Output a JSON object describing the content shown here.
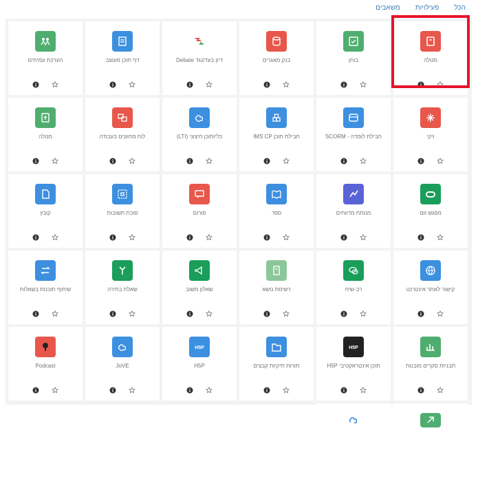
{
  "tabs": [
    {
      "label": "הכל",
      "active": false
    },
    {
      "label": "פעילויות",
      "active": false
    },
    {
      "label": "משאבים",
      "active": true
    }
  ],
  "tiles": [
    {
      "label": "מטלה",
      "color": "#e8574b",
      "icon": "assignment-icon"
    },
    {
      "label": "בוחן",
      "color": "#4fae6f",
      "icon": "quiz-icon"
    },
    {
      "label": "בנק מאגרים",
      "color": "#e8574b",
      "icon": "database-icon"
    },
    {
      "label": "דיון בעד/נגד Debate",
      "color": "#ffffff",
      "icon": "debate-icon"
    },
    {
      "label": "דף תוכן מעוצב",
      "color": "#3d8fe0",
      "icon": "page-icon"
    },
    {
      "label": "הערכת עמיתים",
      "color": "#4fae6f",
      "icon": "workshop-icon"
    },
    {
      "label": "ויקי",
      "color": "#e8574b",
      "icon": "wiki-icon"
    },
    {
      "label": "חבילת לומדה - SCORM",
      "color": "#3d8fe0",
      "icon": "scorm-icon"
    },
    {
      "label": "חבילת תוכן IMS CP",
      "color": "#3d8fe0",
      "icon": "ims-icon"
    },
    {
      "label": "כלי/תוכן חיצוני (LTI)",
      "color": "#3d8fe0",
      "icon": "lti-icon"
    },
    {
      "label": "לוח מחוונים בעבודה",
      "color": "#e8574b",
      "icon": "board-icon"
    },
    {
      "label": "מטלה",
      "color": "#4fae6f",
      "icon": "upload-icon"
    },
    {
      "label": "מפגש זום",
      "color": "#1a9e5a",
      "icon": "zoom-icon"
    },
    {
      "label": "מנותח מדווחים",
      "color": "#5a63d6",
      "icon": "analytics-icon"
    },
    {
      "label": "ספר",
      "color": "#3d8fe0",
      "icon": "book-icon"
    },
    {
      "label": "פורום",
      "color": "#e8574b",
      "icon": "forum-icon"
    },
    {
      "label": "סוכת תשובות",
      "color": "#3d8fe0",
      "icon": "h5p-interactive-icon"
    },
    {
      "label": "קובץ",
      "color": "#3d8fe0",
      "icon": "file-icon"
    },
    {
      "label": "קישור לאתר אינטרנט",
      "color": "#3d8fe0",
      "icon": "url-icon"
    },
    {
      "label": "רב-שיח",
      "color": "#1a9e5a",
      "icon": "chat-icon"
    },
    {
      "label": "רשימת נושא",
      "color": "#8cc79a",
      "icon": "glossary-icon"
    },
    {
      "label": "שאלון משוב",
      "color": "#1a9e5a",
      "icon": "feedback-icon"
    },
    {
      "label": "שאלת בחירה",
      "color": "#1a9e5a",
      "icon": "choice-icon"
    },
    {
      "label": "שיתוף תוכנות בשאלות",
      "color": "#3d8fe0",
      "icon": "share-icon"
    },
    {
      "label": "תבניות סקרים מובנות",
      "color": "#4fae6f",
      "icon": "survey-icon"
    },
    {
      "label": "תוכן אינטראקטיבי H5P",
      "color": "#222222",
      "icon": "h5p-icon"
    },
    {
      "label": "תוויות תיקיות קבצים",
      "color": "#3d8fe0",
      "icon": "folder-icon"
    },
    {
      "label": "H5P",
      "color": "#3d8fe0",
      "icon": "h5p-badge-icon"
    },
    {
      "label": "JoVE",
      "color": "#3d8fe0",
      "icon": "jove-icon"
    },
    {
      "label": "Podcast",
      "color": "#e8574b",
      "icon": "podcast-icon"
    }
  ],
  "last_row": [
    {
      "label": "",
      "color": "#4fae6f",
      "icon": "generic-activity-icon"
    },
    {
      "label": "",
      "color": "#ffffff",
      "icon": "cloud-icon"
    }
  ]
}
